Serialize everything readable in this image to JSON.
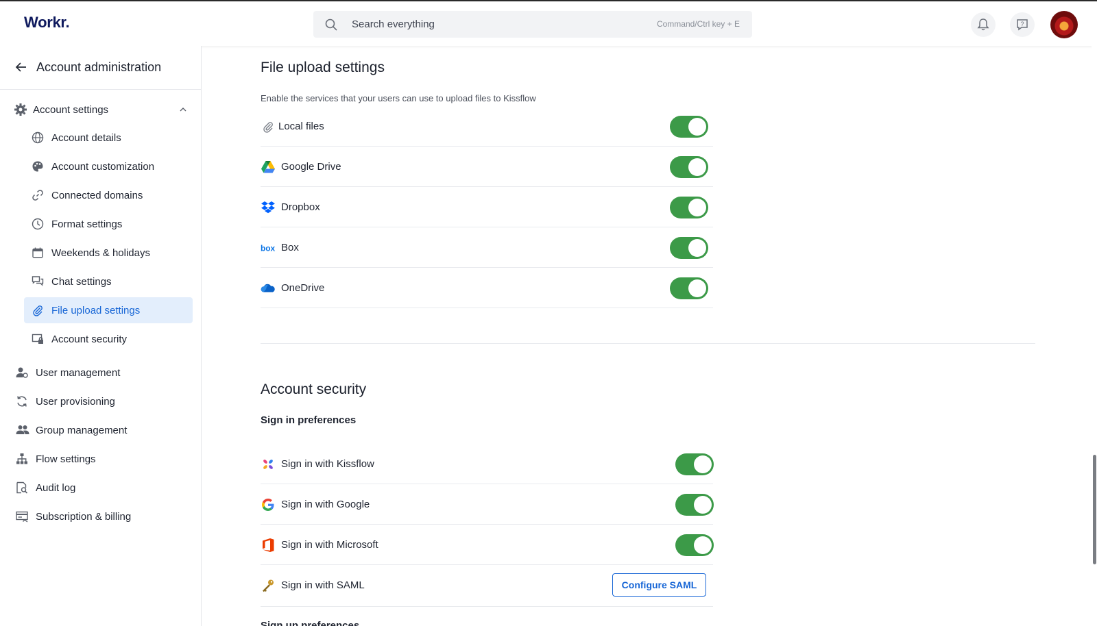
{
  "header": {
    "logo": "Workr.",
    "search_placeholder": "Search everything",
    "search_shortcut": "Command/Ctrl key + E"
  },
  "sidebar": {
    "title": "Account administration",
    "group_label": "Account settings",
    "sub_items": [
      {
        "label": "Account details",
        "icon": "globe-icon"
      },
      {
        "label": "Account customization",
        "icon": "palette-icon"
      },
      {
        "label": "Connected domains",
        "icon": "link-icon"
      },
      {
        "label": "Format settings",
        "icon": "clock-icon"
      },
      {
        "label": "Weekends & holidays",
        "icon": "calendar-icon"
      },
      {
        "label": "Chat settings",
        "icon": "chat-icon"
      },
      {
        "label": "File upload settings",
        "icon": "paperclip-icon",
        "active": true
      },
      {
        "label": "Account security",
        "icon": "lock-screen-icon"
      }
    ],
    "top_items": [
      {
        "label": "User management",
        "icon": "user-gear-icon"
      },
      {
        "label": "User provisioning",
        "icon": "sync-icon"
      },
      {
        "label": "Group management",
        "icon": "group-icon"
      },
      {
        "label": "Flow settings",
        "icon": "hierarchy-icon"
      },
      {
        "label": "Audit log",
        "icon": "audit-icon"
      },
      {
        "label": "Subscription & billing",
        "icon": "billing-icon"
      }
    ]
  },
  "file_upload": {
    "title": "File upload settings",
    "description": "Enable the services that your users can use to upload files to Kissflow",
    "services": [
      {
        "label": "Local files",
        "icon": "paperclip-icon",
        "enabled": true
      },
      {
        "label": "Google Drive",
        "icon": "google-drive-icon",
        "enabled": true
      },
      {
        "label": "Dropbox",
        "icon": "dropbox-icon",
        "enabled": true
      },
      {
        "label": "Box",
        "icon": "box-icon",
        "enabled": true
      },
      {
        "label": "OneDrive",
        "icon": "onedrive-icon",
        "enabled": true
      }
    ]
  },
  "account_security": {
    "title": "Account security",
    "sign_in_heading": "Sign in preferences",
    "sign_in_options": [
      {
        "label": "Sign in with Kissflow",
        "icon": "kissflow-icon",
        "enabled": true
      },
      {
        "label": "Sign in with Google",
        "icon": "google-icon",
        "enabled": true
      },
      {
        "label": "Sign in with Microsoft",
        "icon": "microsoft-office-icon",
        "enabled": true
      }
    ],
    "saml": {
      "label": "Sign in with SAML",
      "icon": "key-icon",
      "button_label": "Configure SAML"
    },
    "sign_up_heading": "Sign up preferences"
  },
  "colors": {
    "accent": "#1766d6",
    "toggle_on": "#3c9a48",
    "active_bg": "#e3eefc"
  }
}
